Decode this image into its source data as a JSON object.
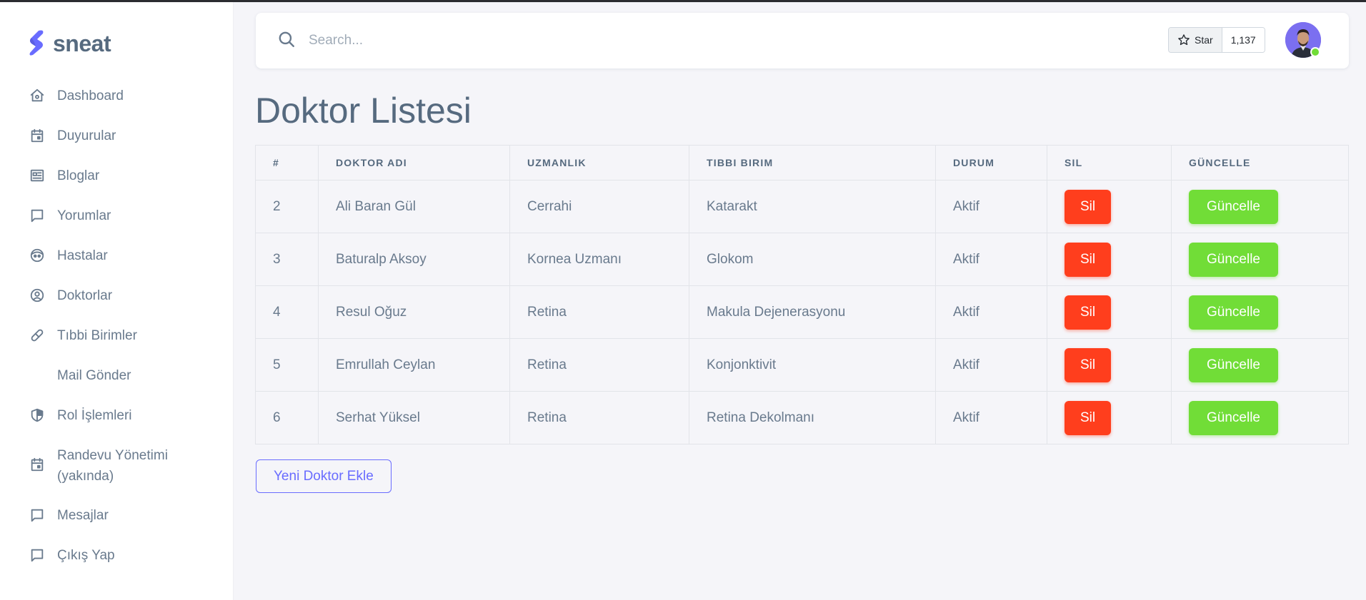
{
  "brand": {
    "name": "sneat",
    "logo_color": "#696cff"
  },
  "sidebar": {
    "items": [
      {
        "label": "Dashboard",
        "icon": "home-icon"
      },
      {
        "label": "Duyurular",
        "icon": "calendar-icon"
      },
      {
        "label": "Bloglar",
        "icon": "news-icon"
      },
      {
        "label": "Yorumlar",
        "icon": "chat-icon"
      },
      {
        "label": "Hastalar",
        "icon": "face-icon"
      },
      {
        "label": "Doktorlar",
        "icon": "user-circle-icon"
      },
      {
        "label": "Tıbbi Birimler",
        "icon": "capsule-icon"
      },
      {
        "label": "Mail Gönder",
        "icon": ""
      },
      {
        "label": "Rol İşlemleri",
        "icon": "shield-icon"
      },
      {
        "label": "Randevu Yönetimi",
        "label2": "(yakında)",
        "icon": "calendar-icon"
      },
      {
        "label": "Mesajlar",
        "icon": "chat-icon"
      },
      {
        "label": "Çıkış Yap",
        "icon": "chat-icon"
      }
    ]
  },
  "navbar": {
    "search_placeholder": "Search...",
    "github": {
      "star_label": "Star",
      "count": "1,137"
    },
    "status_color": "#71dd37"
  },
  "page": {
    "title": "Doktor Listesi"
  },
  "table": {
    "headers": [
      "#",
      "DOKTOR ADI",
      "UZMANLIK",
      "TIBBI BIRIM",
      "DURUM",
      "SIL",
      "GÜNCELLE"
    ],
    "rows": [
      {
        "id": "2",
        "name": "Ali Baran Gül",
        "specialty": "Cerrahi",
        "unit": "Katarakt",
        "status": "Aktif"
      },
      {
        "id": "3",
        "name": "Baturalp Aksoy",
        "specialty": "Kornea Uzmanı",
        "unit": "Glokom",
        "status": "Aktif"
      },
      {
        "id": "4",
        "name": "Resul Oğuz",
        "specialty": "Retina",
        "unit": "Makula Dejenerasyonu",
        "status": "Aktif"
      },
      {
        "id": "5",
        "name": "Emrullah Ceylan",
        "specialty": "Retina",
        "unit": "Konjonktivit",
        "status": "Aktif"
      },
      {
        "id": "6",
        "name": "Serhat Yüksel",
        "specialty": "Retina",
        "unit": "Retina Dekolmanı",
        "status": "Aktif"
      }
    ],
    "delete_label": "Sil",
    "update_label": "Güncelle",
    "delete_color": "#ff3e1d",
    "update_color": "#71dd37"
  },
  "actions": {
    "add_label": "Yeni Doktor Ekle",
    "accent": "#696cff"
  }
}
